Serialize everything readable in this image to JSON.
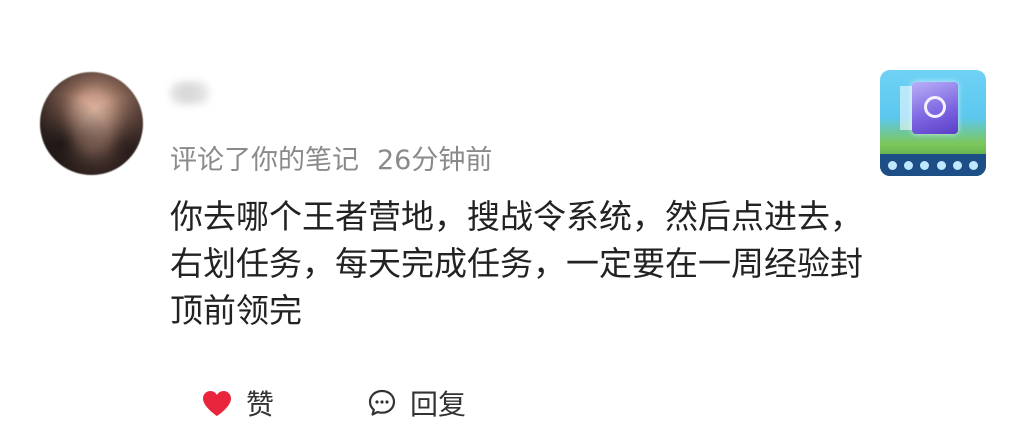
{
  "notification": {
    "action_text": "评论了你的笔记",
    "time": "26分钟前",
    "comment": "你去哪个王者营地，搜战令系统，然后点进去，右划任务，每天完成任务，一定要在一周经验封顶前领完"
  },
  "actions": {
    "like_label": "赞",
    "reply_label": "回复"
  },
  "colors": {
    "heart": "#e8253d",
    "meta_text": "#8a8a8a",
    "comment_text": "#222222"
  }
}
